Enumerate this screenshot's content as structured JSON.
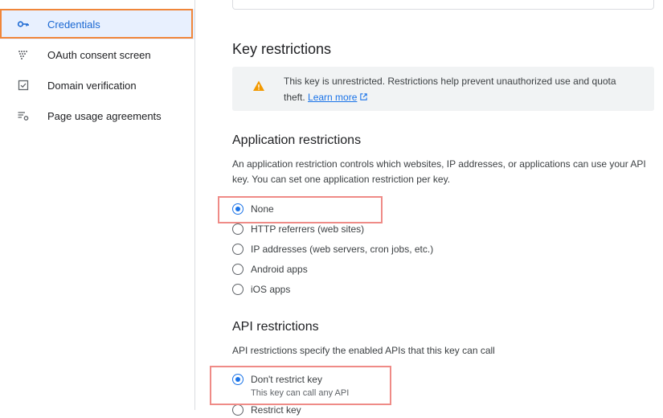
{
  "sidebar": {
    "items": [
      {
        "label": "Credentials",
        "icon": "key-icon",
        "active": true
      },
      {
        "label": "OAuth consent screen",
        "icon": "oauth-consent-icon"
      },
      {
        "label": "Domain verification",
        "icon": "domain-verification-icon"
      },
      {
        "label": "Page usage agreements",
        "icon": "settings-list-icon"
      }
    ]
  },
  "key_restrictions": {
    "title": "Key restrictions",
    "warning_text": "This key is unrestricted. Restrictions help prevent unauthorized use and quota theft.",
    "learn_more": "Learn more"
  },
  "application_restrictions": {
    "title": "Application restrictions",
    "description": "An application restriction controls which websites, IP addresses, or applications can use your API key. You can set one application restriction per key.",
    "options": [
      {
        "label": "None",
        "checked": true
      },
      {
        "label": "HTTP referrers (web sites)",
        "checked": false
      },
      {
        "label": "IP addresses (web servers, cron jobs, etc.)",
        "checked": false
      },
      {
        "label": "Android apps",
        "checked": false
      },
      {
        "label": "iOS apps",
        "checked": false
      }
    ]
  },
  "api_restrictions": {
    "title": "API restrictions",
    "description": "API restrictions specify the enabled APIs that this key can call",
    "options": [
      {
        "label": "Don't restrict key",
        "hint": "This key can call any API",
        "checked": true
      },
      {
        "label": "Restrict key",
        "checked": false
      }
    ]
  },
  "colors": {
    "accent": "#1a73e8",
    "active_bg": "#e8f0fe",
    "warning": "#f29900",
    "annotation_orange": "#f0863a",
    "annotation_red": "#ef8b87"
  }
}
